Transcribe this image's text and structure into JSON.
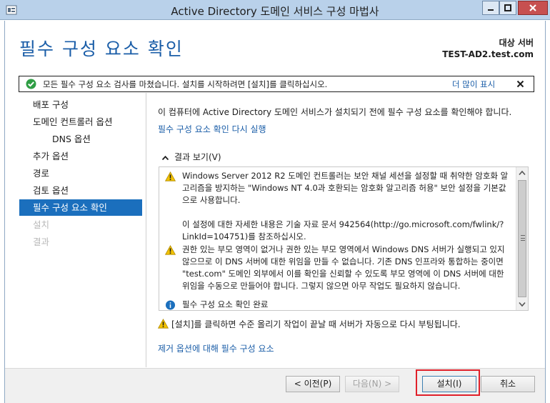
{
  "window": {
    "title": "Active Directory 도메인 서비스 구성 마법사"
  },
  "header": {
    "page_title": "필수 구성 요소 확인",
    "target_label": "대상 서버",
    "target_server": "TEST-AD2.test.com"
  },
  "notice": {
    "message": "모든 필수 구성 요소 검사를 마쳤습니다. 설치를 시작하려면 [설치]를 클릭하십시오.",
    "more_label": "더 많이 표시"
  },
  "nav": {
    "items": [
      {
        "label": "배포 구성",
        "state": "normal"
      },
      {
        "label": "도메인 컨트롤러 옵션",
        "state": "normal"
      },
      {
        "label": "DNS 옵션",
        "state": "normal"
      },
      {
        "label": "추가 옵션",
        "state": "normal"
      },
      {
        "label": "경로",
        "state": "normal"
      },
      {
        "label": "검토 옵션",
        "state": "normal"
      },
      {
        "label": "필수 구성 요소 확인",
        "state": "active"
      },
      {
        "label": "설치",
        "state": "disabled"
      },
      {
        "label": "결과",
        "state": "disabled"
      }
    ]
  },
  "main": {
    "intro": "이 컴퓨터에 Active Directory 도메인 서비스가 설치되기 전에 필수 구성 요소를 확인해야 합니다.",
    "rerun_link": "필수 구성 요소 확인 다시 실행",
    "results_toggle": "결과 보기(V)",
    "results": [
      {
        "icon": "warning-icon",
        "paragraphs": [
          "Windows Server 2012 R2 도메인 컨트롤러는 보안 채널 세션을 설정할 때 취약한 암호화 알고리즘을 방지하는 \"Windows NT 4.0과 호환되는 암호화 알고리즘 허용\" 보안 설정을 기본값으로 사용합니다.",
          "이 설정에 대한 자세한 내용은 기술 자료 문서 942564(http://go.microsoft.com/fwlink/?LinkId=104751)를 참조하십시오."
        ]
      },
      {
        "icon": "warning-icon",
        "paragraphs": [
          "권한 있는 부모 영역이 없거나 권한 있는 부모 영역에서 Windows DNS 서버가 실행되고 있지 않으므로 이 DNS 서버에 대한 위임을 만들 수 없습니다. 기존 DNS 인프라와 통합하는 중이면 \"test.com\" 도메인 외부에서 이를 확인을 신뢰할 수 있도록 부모 영역에 이 DNS 서버에 대한 위임을 수동으로 만들어야 합니다. 그렇지 않으면 아무 작업도 필요하지 않습니다."
        ]
      },
      {
        "icon": "info-icon",
        "paragraphs": [
          "필수 구성 요소 확인 완료"
        ]
      }
    ],
    "reboot_notice": "[설치]를 클릭하면 수준 올리기 작업이 끝날 때 서버가 자동으로 다시 부팅됩니다.",
    "removal_link": "제거 옵션에 대해 필수 구성 요소"
  },
  "footer": {
    "prev_label": "< 이전(P)",
    "next_label": "다음(N) >",
    "install_label": "설치(I)",
    "cancel_label": "취소"
  },
  "colors": {
    "accent": "#1b6fbd",
    "link": "#1b5ea8",
    "warning": "#f2c200",
    "success": "#2f9e44",
    "highlight": "#e0202a"
  }
}
